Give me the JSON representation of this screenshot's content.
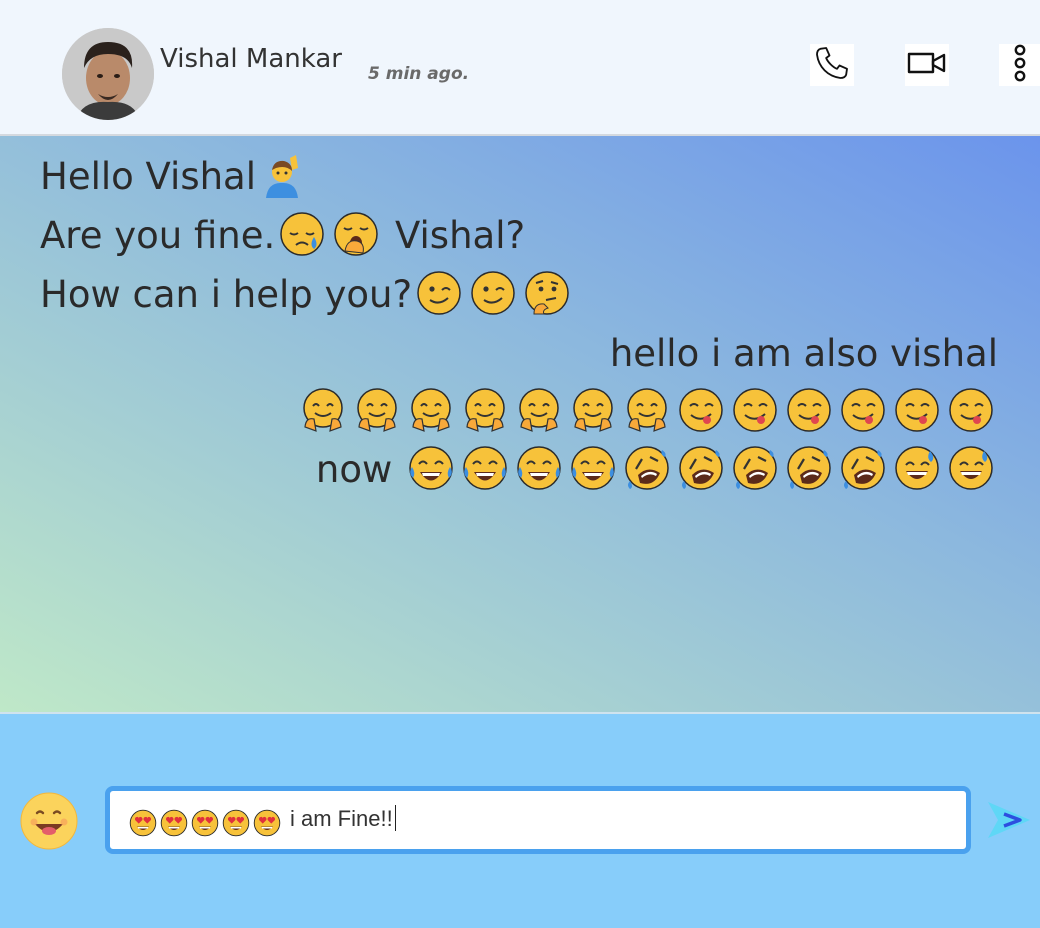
{
  "header": {
    "contact_name": "Vishal Mankar",
    "last_seen": "5 min ago.",
    "icons": {
      "call": "phone-icon",
      "video": "video-camera-icon",
      "more": "more-vertical-icon"
    }
  },
  "conversation": {
    "incoming": [
      {
        "text": "Hello Vishal",
        "emojis": [
          "person-raising-hand"
        ]
      },
      {
        "text_before": "Are you fine.",
        "emojis": [
          "sad-relieved-face",
          "yawning-face"
        ],
        "text_after": " Vishal?"
      },
      {
        "text": "How can i help you?",
        "emojis": [
          "winking-face",
          "winking-face",
          "thinking-face"
        ]
      }
    ],
    "outgoing": [
      {
        "text": "hello i am also vishal"
      },
      {
        "emojis": [
          "hugging-face",
          "hugging-face",
          "hugging-face",
          "hugging-face",
          "hugging-face",
          "hugging-face",
          "hugging-face",
          "savoring-food-face",
          "savoring-food-face",
          "savoring-food-face",
          "savoring-food-face",
          "savoring-food-face",
          "savoring-food-face"
        ]
      },
      {
        "text": "now",
        "emojis": [
          "tears-of-joy",
          "tears-of-joy",
          "tears-of-joy",
          "tears-of-joy",
          "rolling-on-floor-laughing",
          "rolling-on-floor-laughing",
          "rolling-on-floor-laughing",
          "rolling-on-floor-laughing",
          "rolling-on-floor-laughing",
          "grinning-sweat",
          "grinning-sweat"
        ]
      }
    ]
  },
  "composer": {
    "emoji_button_icon": "smiley-icon",
    "input_emojis": [
      "heart-eyes",
      "heart-eyes",
      "heart-eyes",
      "heart-eyes",
      "heart-eyes"
    ],
    "input_text": "i am Fine!!",
    "send_icon": "send-icon"
  },
  "colors": {
    "header_bg": "#f0f6fd",
    "composer_bg": "#87cdfa",
    "input_border": "#4aa1ee",
    "emoji_yellow": "#f7c23a"
  }
}
